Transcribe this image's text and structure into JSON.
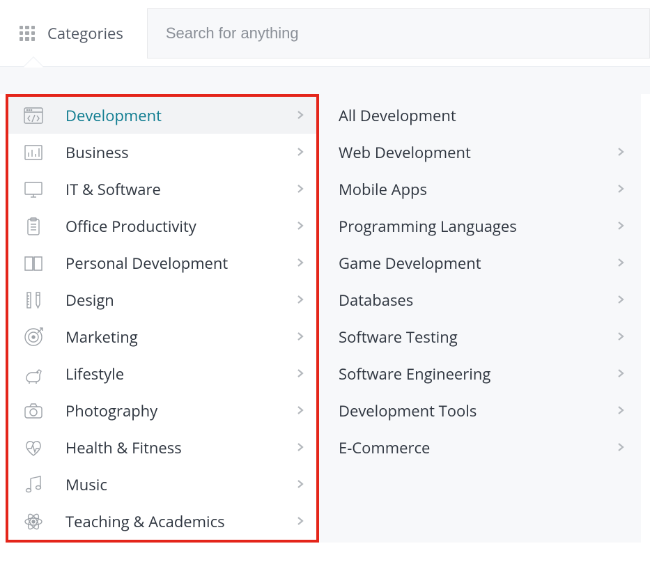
{
  "header": {
    "categories_label": "Categories",
    "search_placeholder": "Search for anything"
  },
  "categories": [
    {
      "label": "Development",
      "icon": "code-window-icon",
      "active": true
    },
    {
      "label": "Business",
      "icon": "bar-chart-icon",
      "active": false
    },
    {
      "label": "IT & Software",
      "icon": "monitor-icon",
      "active": false
    },
    {
      "label": "Office Productivity",
      "icon": "clipboard-icon",
      "active": false
    },
    {
      "label": "Personal Development",
      "icon": "book-icon",
      "active": false
    },
    {
      "label": "Design",
      "icon": "pencil-ruler-icon",
      "active": false
    },
    {
      "label": "Marketing",
      "icon": "target-icon",
      "active": false
    },
    {
      "label": "Lifestyle",
      "icon": "dog-icon",
      "active": false
    },
    {
      "label": "Photography",
      "icon": "camera-icon",
      "active": false
    },
    {
      "label": "Health & Fitness",
      "icon": "heartbeat-icon",
      "active": false
    },
    {
      "label": "Music",
      "icon": "music-icon",
      "active": false
    },
    {
      "label": "Teaching & Academics",
      "icon": "atom-icon",
      "active": false
    }
  ],
  "subcategories": [
    {
      "label": "All Development",
      "has_children": false
    },
    {
      "label": "Web Development",
      "has_children": true
    },
    {
      "label": "Mobile Apps",
      "has_children": true
    },
    {
      "label": "Programming Languages",
      "has_children": true
    },
    {
      "label": "Game Development",
      "has_children": true
    },
    {
      "label": "Databases",
      "has_children": true
    },
    {
      "label": "Software Testing",
      "has_children": true
    },
    {
      "label": "Software Engineering",
      "has_children": true
    },
    {
      "label": "Development Tools",
      "has_children": true
    },
    {
      "label": "E-Commerce",
      "has_children": true
    }
  ]
}
